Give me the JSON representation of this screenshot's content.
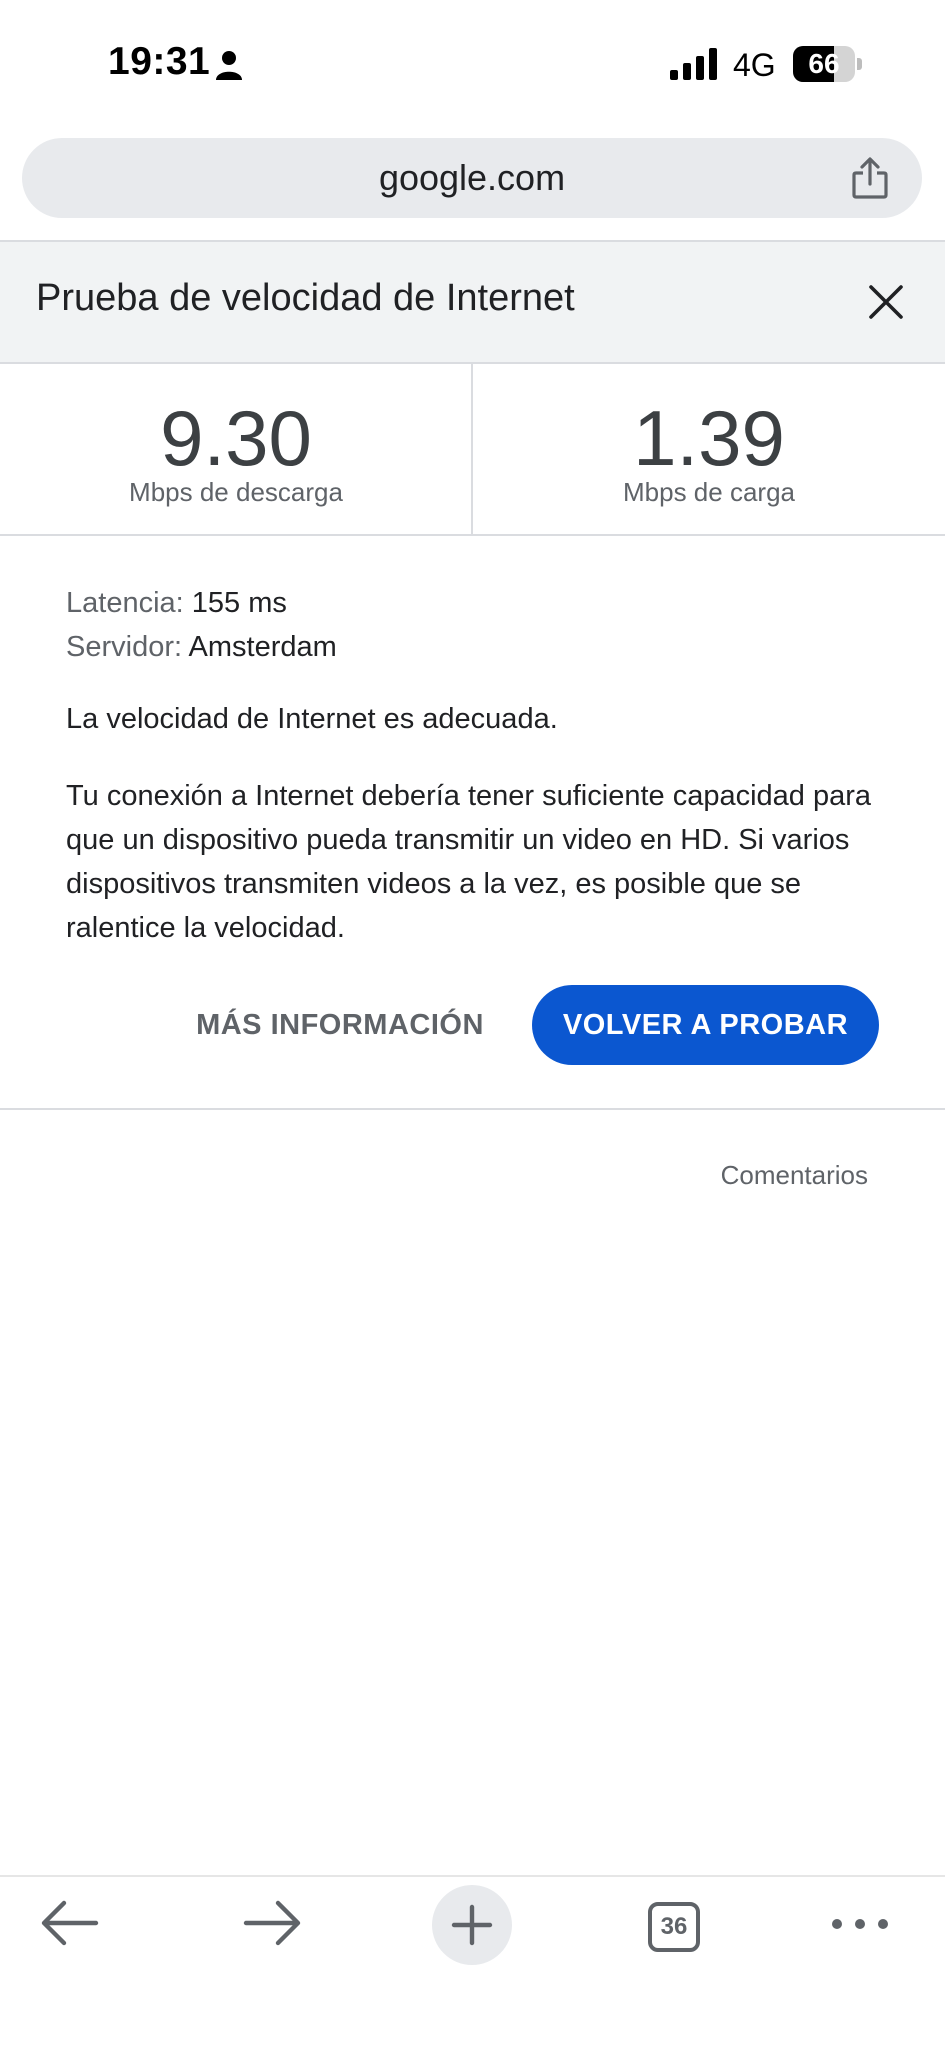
{
  "status_bar": {
    "time": "19:31",
    "network": "4G",
    "battery_level": "66",
    "battery_fraction": 0.66
  },
  "address_bar": {
    "url": "google.com"
  },
  "speed_test": {
    "title": "Prueba de velocidad de Internet",
    "download": {
      "value": "9.30",
      "label": "Mbps de descarga"
    },
    "upload": {
      "value": "1.39",
      "label": "Mbps de carga"
    },
    "latency": {
      "key": "Latencia:",
      "value": "155 ms"
    },
    "server": {
      "key": "Servidor:",
      "value": "Amsterdam"
    },
    "verdict": "La velocidad de Internet es adecuada.",
    "explanation": "Tu conexión a Internet debería tener suficiente capacidad para que un dispositivo pueda transmitir un video en HD. Si varios dispositivos transmiten videos a la vez, es posible que se ralentice la velocidad.",
    "more_info_label": "MÁS INFORMACIÓN",
    "retry_label": "VOLVER A PROBAR",
    "feedback_label": "Comentarios"
  },
  "toolbar": {
    "tab_count": "36"
  },
  "colors": {
    "accent": "#0b57d0",
    "header_bg": "#f1f3f4",
    "address_bg": "#e8eaed"
  }
}
